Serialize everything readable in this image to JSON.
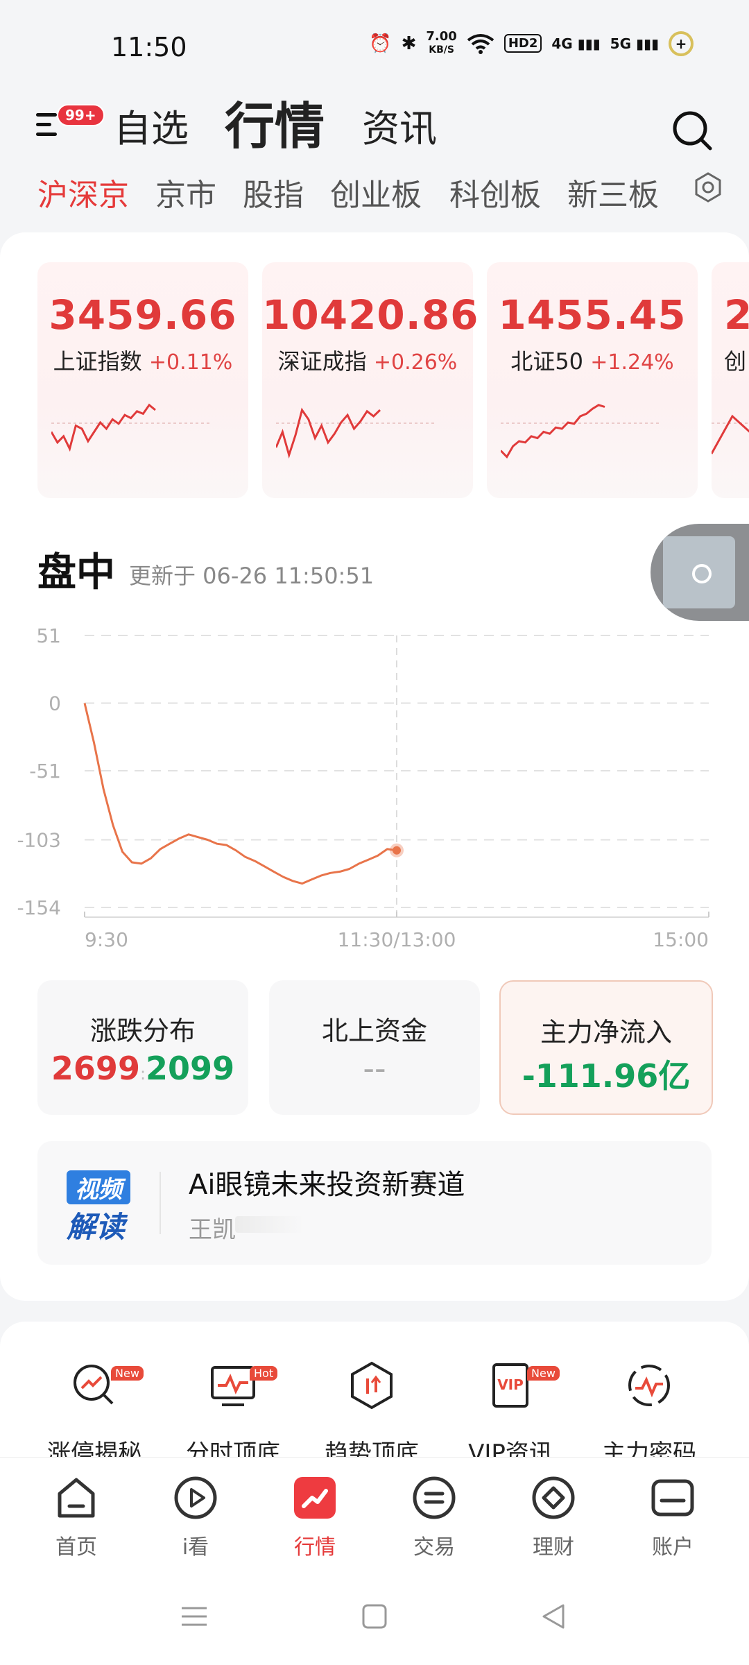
{
  "status_bar": {
    "time": "11:50",
    "speed_value": "7.00",
    "speed_unit": "KB/S",
    "hd": "HD2",
    "net1": "4G",
    "net2": "5G",
    "battery": "+"
  },
  "header": {
    "badge": "99+",
    "tabs": [
      {
        "label": "自选",
        "active": false
      },
      {
        "label": "行情",
        "active": true
      },
      {
        "label": "资讯",
        "active": false
      }
    ]
  },
  "subtabs": [
    {
      "label": "沪深京",
      "active": true
    },
    {
      "label": "京市",
      "active": false
    },
    {
      "label": "股指",
      "active": false
    },
    {
      "label": "创业板",
      "active": false
    },
    {
      "label": "科创板",
      "active": false
    },
    {
      "label": "新三板",
      "active": false
    }
  ],
  "indices": [
    {
      "value": "3459.66",
      "name": "上证指数",
      "change": "+0.11%",
      "spark": [
        0.55,
        0.72,
        0.62,
        0.82,
        0.45,
        0.5,
        0.7,
        0.55,
        0.4,
        0.5,
        0.35,
        0.42,
        0.28,
        0.33,
        0.22,
        0.26,
        0.12,
        0.2
      ]
    },
    {
      "value": "10420.86",
      "name": "深证成指",
      "change": "+0.26%",
      "spark": [
        0.8,
        0.55,
        0.92,
        0.6,
        0.2,
        0.35,
        0.65,
        0.45,
        0.72,
        0.58,
        0.4,
        0.28,
        0.5,
        0.38,
        0.22,
        0.3,
        0.2
      ]
    },
    {
      "value": "1455.45",
      "name": "北证50",
      "change": "+1.24%",
      "spark": [
        0.85,
        0.95,
        0.78,
        0.7,
        0.72,
        0.62,
        0.65,
        0.55,
        0.58,
        0.48,
        0.5,
        0.4,
        0.42,
        0.3,
        0.26,
        0.18,
        0.12,
        0.15
      ]
    },
    {
      "value": "2",
      "name": "创",
      "change": "",
      "spark": [
        0.9,
        0.3,
        0.6,
        0.8,
        0.2,
        0.5
      ]
    }
  ],
  "intraday": {
    "title": "盘中",
    "updated": "更新于 06-26 11:50:51",
    "y_ticks": [
      "51",
      "0",
      "-51",
      "-103",
      "-154"
    ],
    "x_ticks": [
      "9:30",
      "11:30/13:00",
      "15:00"
    ]
  },
  "chart_data": {
    "type": "line",
    "title": "盘中",
    "xlabel": "",
    "ylabel": "",
    "ylim": [
      -154,
      51
    ],
    "x_ticks": [
      "9:30",
      "11:30/13:00",
      "15:00"
    ],
    "y_ticks": [
      51,
      0,
      -51,
      -103,
      -154
    ],
    "series": [
      {
        "values": [
          0,
          -30,
          -65,
          -92,
          -112,
          -120,
          -121,
          -117,
          -110,
          -106,
          -102,
          -99,
          -101,
          -103,
          -106,
          -107,
          -111,
          -116,
          -119,
          -123,
          -127,
          -131,
          -134,
          -136,
          -133,
          -130,
          -128,
          -127,
          -125,
          -121,
          -118,
          -115,
          -110,
          -111
        ]
      }
    ],
    "x_points_total": 67
  },
  "stats": [
    {
      "label": "涨跌分布",
      "up": "2699",
      "sep": ":",
      "down": "2099"
    },
    {
      "label": "北上资金",
      "value": "--"
    },
    {
      "label": "主力净流入",
      "value": "-111.96亿"
    }
  ],
  "video": {
    "logo_top": "视频",
    "logo_bottom": "解读",
    "title": "Ai眼镜未来投资新赛道",
    "author": "王凯"
  },
  "tools": [
    {
      "label": "涨停揭秘",
      "badge": "New",
      "icon": "magnifier-chart-icon"
    },
    {
      "label": "分时顶底",
      "badge": "Hot",
      "icon": "monitor-chart-icon"
    },
    {
      "label": "趋势顶底",
      "badge": "",
      "icon": "hexagon-arrows-icon"
    },
    {
      "label": "VIP资讯",
      "badge": "New",
      "icon": "vip-document-icon"
    },
    {
      "label": "主力密码",
      "badge": "",
      "icon": "target-chart-icon"
    }
  ],
  "bottom_nav": [
    {
      "label": "首页",
      "icon": "home-icon",
      "active": false
    },
    {
      "label": "i看",
      "icon": "play-icon",
      "active": false
    },
    {
      "label": "行情",
      "icon": "market-icon",
      "active": true
    },
    {
      "label": "交易",
      "icon": "trade-icon",
      "active": false
    },
    {
      "label": "理财",
      "icon": "wealth-icon",
      "active": false
    },
    {
      "label": "账户",
      "icon": "account-icon",
      "active": false
    }
  ],
  "colors": {
    "up": "#e03a3a",
    "down": "#14a05a",
    "accent": "#e53a3a",
    "line": "#e8744a"
  }
}
